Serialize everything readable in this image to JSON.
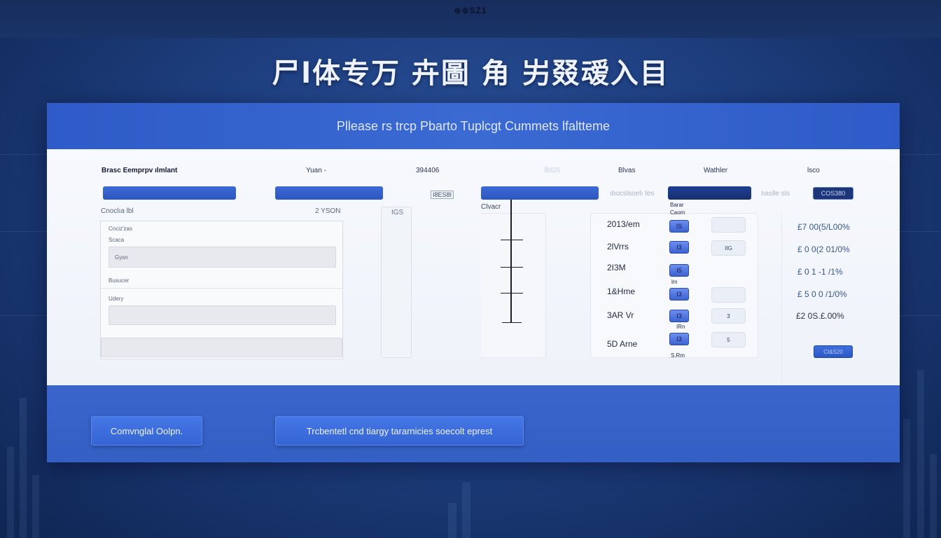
{
  "top_strip": {
    "code": "⊕⊕SZ1"
  },
  "title": "尸l体专万 卉圖 角 屴叕叆入目",
  "card": {
    "header_text": "Pllease rs trcp Pbarto Tuplcgt Cummets lfaltteme",
    "columns": {
      "c1": "Brasc Eemprpv ılmlant",
      "c2": "Yuan -",
      "c3": "394406",
      "c4": "llbl26",
      "c5": "Blvas",
      "c6": "Wathler",
      "c7": "lsco"
    },
    "bar_labels": {
      "mid_label": "I8ES8I",
      "faint_left": "ıbocslsoelı Ies",
      "faint_right": "Iıaslle sls",
      "button": "COS380"
    },
    "sublabels": {
      "left": "Cnoclıa lbl",
      "mid": "2 YSON",
      "scroll": "IGS",
      "timeline": "Clvacr"
    },
    "form": {
      "sec1_label": "Cnciz'zas",
      "sec1_sub": "Scaca",
      "sec1_input": "Gysn",
      "sec1_foot": "Busucer",
      "sec2_label": "Udery"
    },
    "list": {
      "header_chip_label": "Bacar\nCaom",
      "rows": [
        {
          "label": "2013/em",
          "chip": "IS",
          "slot": ""
        },
        {
          "label": "2lVrrs",
          "chip": "I3",
          "slot": "IIG"
        },
        {
          "label": "2I3M",
          "chip": "I5",
          "slot": ""
        },
        {
          "label": "1&Hme",
          "chip": "I3",
          "slot": ""
        },
        {
          "label": "3AR Vr",
          "chip": "I3",
          "slot": "3"
        },
        {
          "label": "5D Arne",
          "chip": "I3",
          "slot": "5"
        }
      ],
      "tiny_labels": [
        "Barar",
        "Caom",
        "lm",
        "S.Rm",
        "IRn",
        "lm"
      ]
    },
    "values": [
      "£7 00(5/L00%",
      "£ 0 0(2 01/0%",
      "£ 0 1 -1 /1%",
      "£ 5 0 0 /1/0%",
      "£2 0S.£.00%"
    ],
    "small_btn": "CI&S20",
    "footer": {
      "btn1": "Comvnglal Oolpn.",
      "btn2": "Trcbentetl cnd tiargy tararnicies soecolt eprest"
    }
  }
}
